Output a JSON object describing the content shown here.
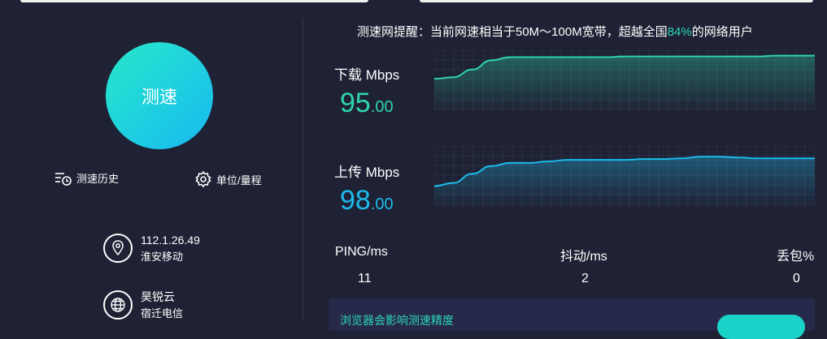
{
  "notice": {
    "prefix": "测速网提醒：当前网速相当于50M～100M宽带，超越全国",
    "percent": "84%",
    "suffix": "的网络用户"
  },
  "speed_button": {
    "label": "测速"
  },
  "tools": {
    "history": "测速历史",
    "unit": "单位/量程"
  },
  "client": {
    "ip": "112.1.26.49",
    "isp": "淮安移动"
  },
  "server": {
    "name": "昊锐云",
    "isp": "宿迁电信"
  },
  "download": {
    "label": "下载 Mbps",
    "int": "95",
    "dec": ".00"
  },
  "upload": {
    "label": "上传 Mbps",
    "int": "98",
    "dec": ".00"
  },
  "stats": {
    "ping_label": "PING/ms",
    "ping_value": "11",
    "jitter_label": "抖动/ms",
    "jitter_value": "2",
    "loss_label": "丢包%",
    "loss_value": "0"
  },
  "tip": {
    "text": "浏览器会影响测速精度"
  },
  "colors": {
    "download": "#2ed4ae",
    "upload": "#1dbbec",
    "highlight": "#2bd8b8"
  },
  "chart_data": [
    {
      "type": "area",
      "title": "",
      "xlabel": "",
      "ylabel": "",
      "series": [
        {
          "values": [
            43,
            45,
            55,
            67,
            71,
            71,
            71,
            71,
            71,
            71,
            72,
            72,
            72,
            72,
            72,
            72,
            72,
            72,
            73,
            73,
            73
          ]
        }
      ]
    },
    {
      "type": "area",
      "title": "",
      "xlabel": "",
      "ylabel": "",
      "series": [
        {
          "values": [
            28,
            32,
            44,
            54,
            58,
            58,
            60,
            62,
            62,
            62,
            62,
            63,
            63,
            64,
            66,
            66,
            65,
            64,
            64,
            64,
            64
          ]
        }
      ]
    }
  ]
}
